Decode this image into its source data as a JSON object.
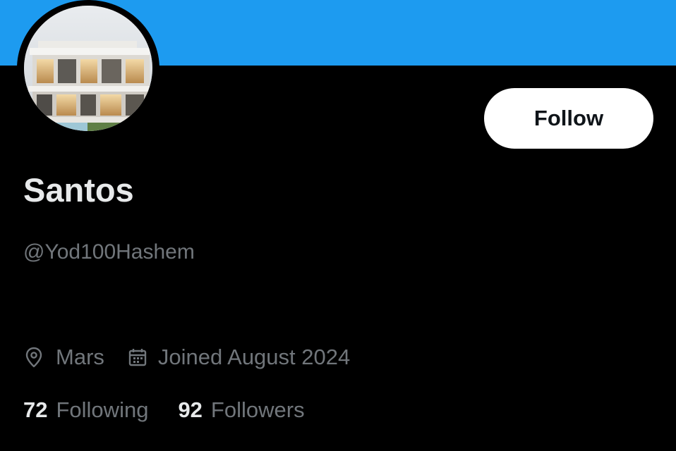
{
  "profile": {
    "display_name": "Santos",
    "handle": "@Yod100Hashem",
    "location": "Mars",
    "joined": "Joined August 2024",
    "avatar_description": "avatar-house-photo"
  },
  "actions": {
    "follow_label": "Follow"
  },
  "stats": {
    "following_count": "72",
    "following_label": "Following",
    "followers_count": "92",
    "followers_label": "Followers"
  },
  "icons": {
    "location": "location-pin-icon",
    "joined": "calendar-icon"
  },
  "colors": {
    "banner": "#1d9bf0",
    "background": "#000000",
    "primary_text": "#e7e9ea",
    "secondary_text": "#71767b",
    "follow_button_bg": "#ffffff",
    "follow_button_text": "#0f1419"
  }
}
